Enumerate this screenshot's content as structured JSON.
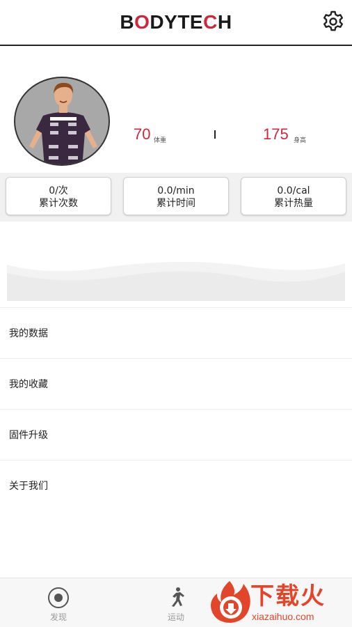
{
  "header": {
    "brand_prefix": "B",
    "brand_mid": "DYTE",
    "brand_accent": "C",
    "brand_suffix": "H",
    "settings_icon": "gear-icon"
  },
  "profile": {
    "avatar_icon": "avatar-figure",
    "weight_value": "70",
    "weight_unit": "体重",
    "height_value": "175",
    "height_unit": "身高"
  },
  "stats": [
    {
      "value": "0/次",
      "label": "累计次数"
    },
    {
      "value": "0.0/min",
      "label": "累计时间"
    },
    {
      "value": "0.0/cal",
      "label": "累计热量"
    }
  ],
  "menu": [
    {
      "label": "我的数据"
    },
    {
      "label": "我的收藏"
    },
    {
      "label": "固件升级"
    },
    {
      "label": "关于我们"
    }
  ],
  "tabbar": {
    "tabs": [
      {
        "label": "发现",
        "icon": "target-icon"
      },
      {
        "label": "运动",
        "icon": "runner-icon"
      }
    ]
  },
  "watermark": {
    "cn": "下载火",
    "en": "xiazaihuo.com"
  },
  "colors": {
    "accent": "#d0263d",
    "watermark": "#e2452a"
  }
}
